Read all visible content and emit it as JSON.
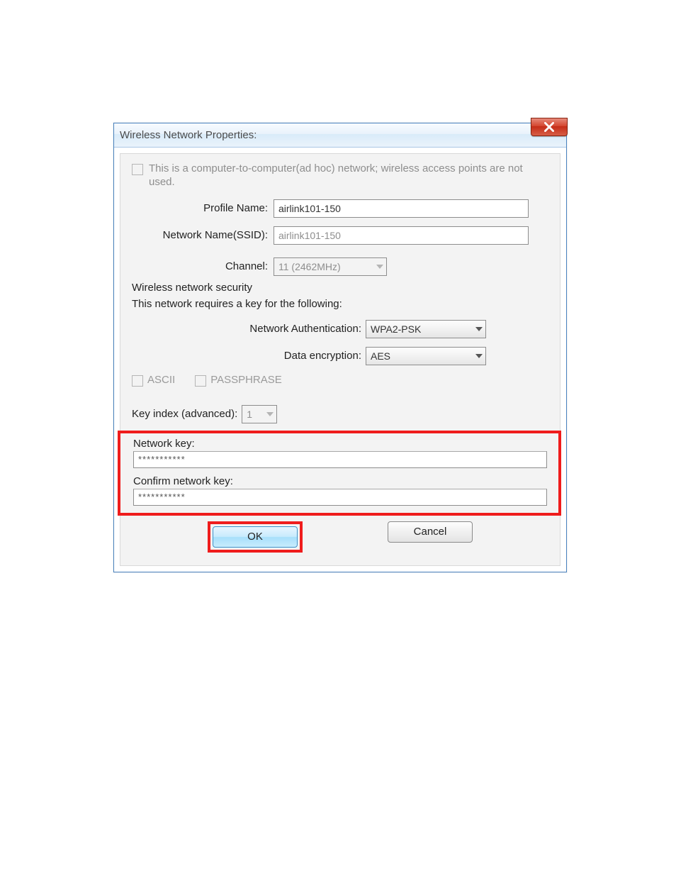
{
  "window": {
    "title": "Wireless Network Properties:"
  },
  "adhoc": {
    "text": "This is a computer-to-computer(ad hoc) network; wireless access points are not used."
  },
  "profile": {
    "name_label": "Profile Name:",
    "name_value": "airlink101-150",
    "ssid_label": "Network Name(SSID):",
    "ssid_value": "airlink101-150",
    "channel_label": "Channel:",
    "channel_value": "11 (2462MHz)"
  },
  "security": {
    "legend": "Wireless network security",
    "subtext": "This network requires a key for the following:",
    "auth_label": "Network Authentication:",
    "auth_value": "WPA2-PSK",
    "enc_label": "Data encryption:",
    "enc_value": "AES",
    "ascii_label": "ASCII",
    "passphrase_label": "PASSPHRASE",
    "keyidx_label": "Key index (advanced):",
    "keyidx_value": "1",
    "netkey_label": "Network key:",
    "netkey_value": "***********",
    "confirm_label": "Confirm network key:",
    "confirm_value": "***********"
  },
  "buttons": {
    "ok": "OK",
    "cancel": "Cancel"
  }
}
